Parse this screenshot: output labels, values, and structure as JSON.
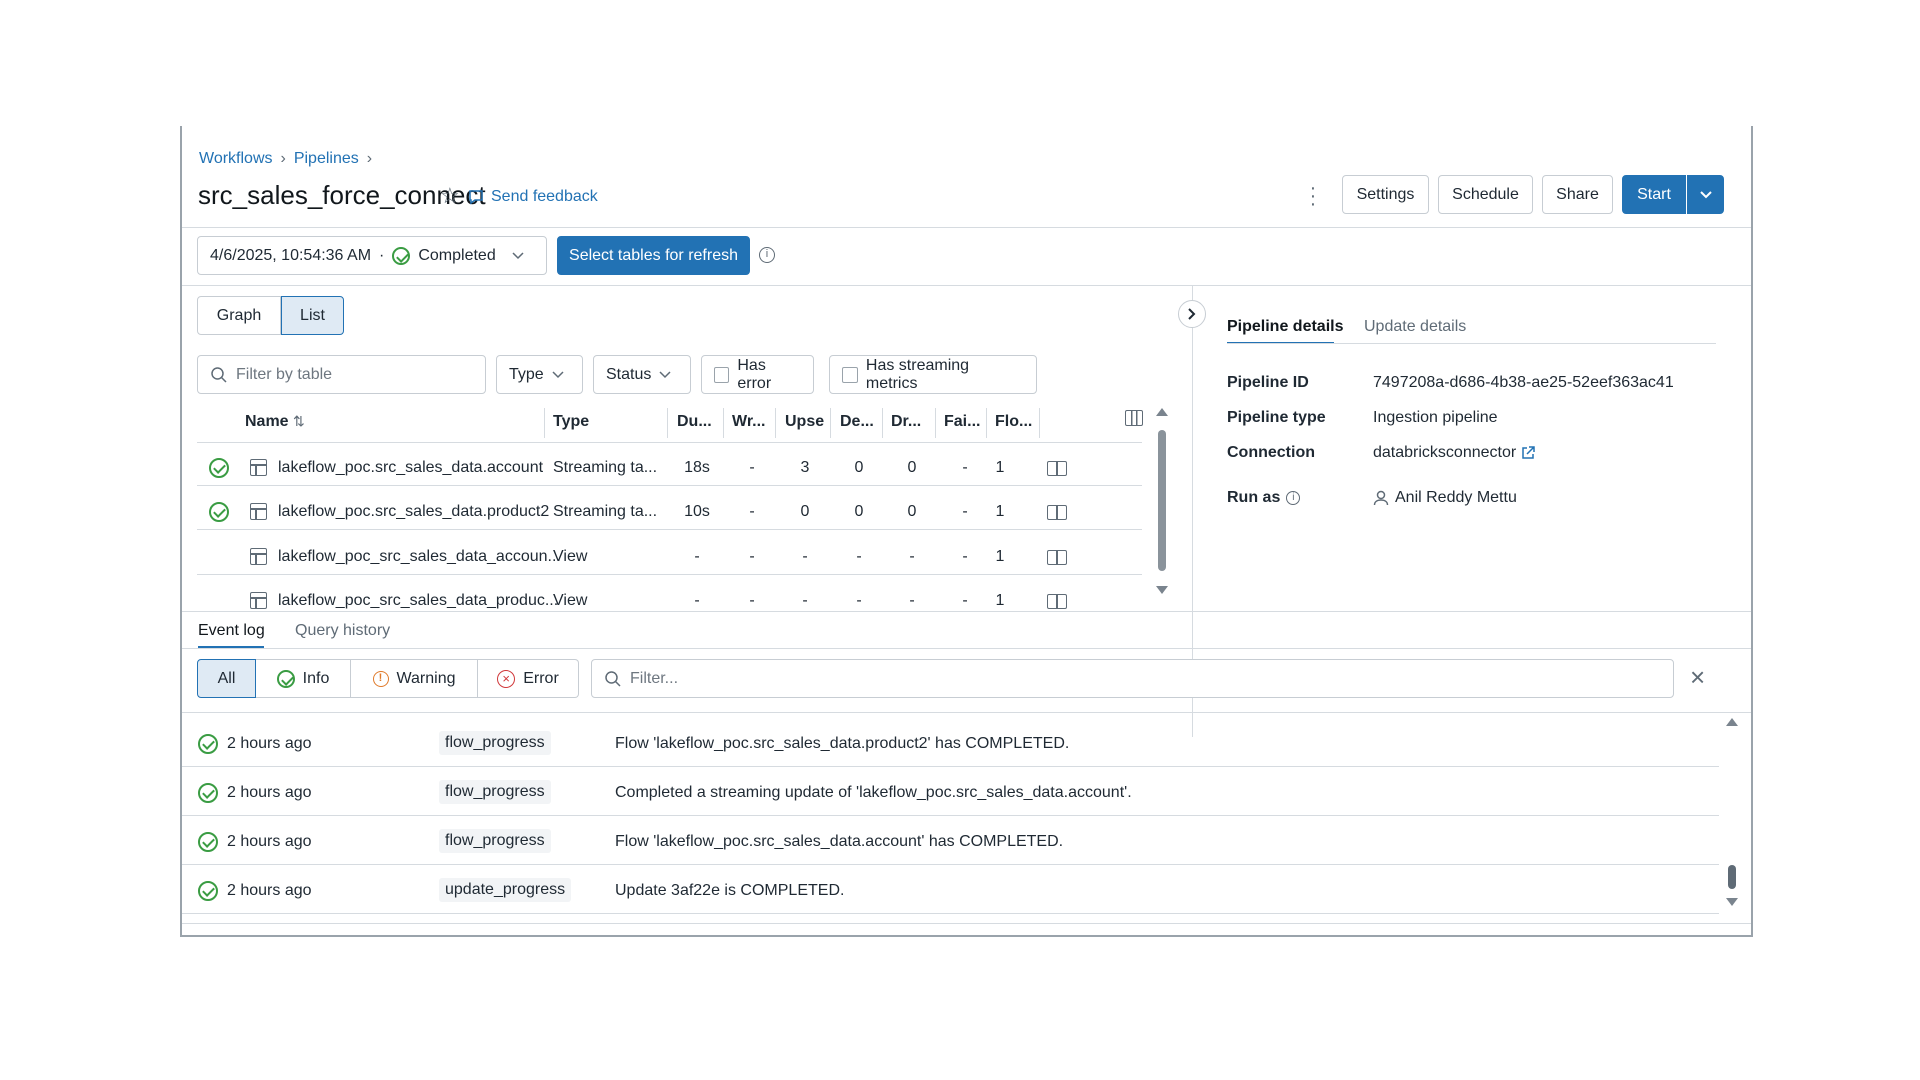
{
  "breadcrumb": [
    "Workflows",
    "Pipelines"
  ],
  "pipeline_name": "src_sales_force_connect",
  "send_feedback": "Send feedback",
  "header_buttons": {
    "settings": "Settings",
    "schedule": "Schedule",
    "share": "Share",
    "start": "Start"
  },
  "run": {
    "timestamp": "4/6/2025, 10:54:36 AM",
    "separator": "·",
    "status": "Completed"
  },
  "select_tables_button": "Select tables for refresh",
  "view_toggle": {
    "graph": "Graph",
    "list": "List",
    "selected": "List"
  },
  "filters": {
    "table_placeholder": "Filter by table",
    "type": "Type",
    "status": "Status",
    "has_error": "Has error",
    "has_streaming": "Has streaming metrics"
  },
  "table": {
    "columns": [
      "Name",
      "Type",
      "Du...",
      "Wr...",
      "Upse",
      "De...",
      "Dr...",
      "Fai...",
      "Flo..."
    ],
    "rows": [
      {
        "status": "ok",
        "name": "lakeflow_poc.src_sales_data.account",
        "type": "Streaming ta...",
        "cells": [
          "18s",
          "-",
          "3",
          "0",
          "0",
          "-",
          "1"
        ]
      },
      {
        "status": "ok",
        "name": "lakeflow_poc.src_sales_data.product2",
        "type": "Streaming ta...",
        "cells": [
          "10s",
          "-",
          "0",
          "0",
          "0",
          "-",
          "1"
        ]
      },
      {
        "status": "none",
        "name": "lakeflow_poc_src_sales_data_accoun...",
        "type": "View",
        "cells": [
          "-",
          "-",
          "-",
          "-",
          "-",
          "-",
          "1"
        ]
      },
      {
        "status": "none",
        "name": "lakeflow_poc_src_sales_data_produc...",
        "type": "View",
        "cells": [
          "-",
          "-",
          "-",
          "-",
          "-",
          "-",
          "1"
        ]
      }
    ]
  },
  "details": {
    "tabs": [
      "Pipeline details",
      "Update details"
    ],
    "active_tab": "Pipeline details",
    "fields": [
      {
        "label": "Pipeline ID",
        "value": "7497208a-d686-4b38-ae25-52eef363ac41"
      },
      {
        "label": "Pipeline type",
        "value": "Ingestion pipeline"
      },
      {
        "label": "Connection",
        "value": "databricksconnector"
      },
      {
        "label": "Run as",
        "value": "Anil Reddy Mettu"
      }
    ]
  },
  "bottom_tabs": {
    "event_log": "Event log",
    "query_history": "Query history"
  },
  "log_filters": {
    "all": "All",
    "info": "Info",
    "warning": "Warning",
    "error": "Error",
    "filter_placeholder": "Filter..."
  },
  "events": [
    {
      "time": "2 hours ago",
      "type": "flow_progress",
      "message": "Flow 'lakeflow_poc.src_sales_data.product2' has COMPLETED."
    },
    {
      "time": "2 hours ago",
      "type": "flow_progress",
      "message": "Completed a streaming update of 'lakeflow_poc.src_sales_data.account'."
    },
    {
      "time": "2 hours ago",
      "type": "flow_progress",
      "message": "Flow 'lakeflow_poc.src_sales_data.account' has COMPLETED."
    },
    {
      "time": "2 hours ago",
      "type": "update_progress",
      "message": "Update 3af22e is COMPLETED."
    }
  ],
  "colors": {
    "accent": "#2272b4",
    "success": "#3a9c43",
    "warning": "#e07b2c",
    "error": "#d0383a"
  }
}
